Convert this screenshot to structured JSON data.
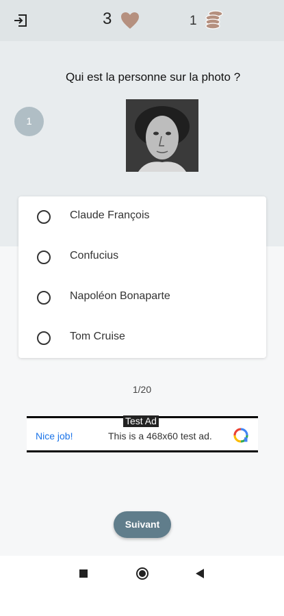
{
  "header": {
    "lives": "3",
    "coins": "1"
  },
  "quiz": {
    "question": "Qui est la personne sur la photo ?",
    "number": "1",
    "options": [
      {
        "label": "Claude François"
      },
      {
        "label": "Confucius"
      },
      {
        "label": "Napoléon Bonaparte"
      },
      {
        "label": "Tom Cruise"
      }
    ],
    "progress": "1/20",
    "next_label": "Suivant"
  },
  "ad": {
    "tag": "Test Ad",
    "nice": "Nice job!",
    "text": "This is a 468x60 test ad."
  },
  "colors": {
    "header_bg": "#dfe4e6",
    "accent": "#607d8b",
    "number_badge": "#b0bec5",
    "heart": "#b5907f"
  },
  "icons": {
    "exit": "exit-icon",
    "lives": "heart-icon",
    "coins": "coins-icon",
    "nav_recents": "square-icon",
    "nav_home": "circle-icon",
    "nav_back": "triangle-back-icon"
  }
}
